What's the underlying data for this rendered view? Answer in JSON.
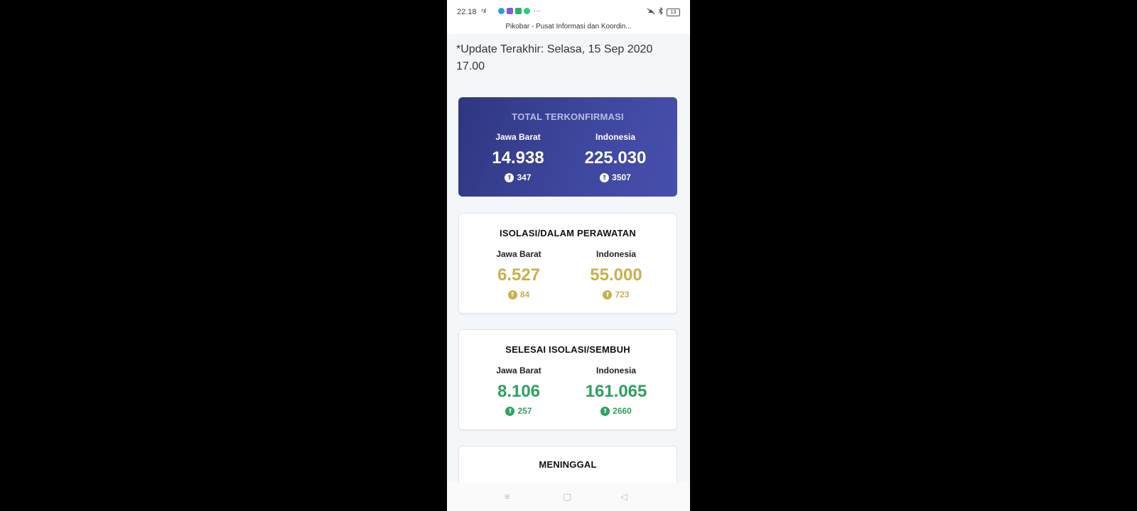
{
  "status_bar": {
    "time": "22.18",
    "signal": "ˢ.ıl",
    "battery": "13",
    "apps": [
      {
        "icon": "telegram-icon",
        "color": "#2a9fd6"
      },
      {
        "icon": "app-icon",
        "color": "#7b5fd9"
      },
      {
        "icon": "chat-icon",
        "color": "#28b463"
      },
      {
        "icon": "whatsapp-icon",
        "color": "#2ecc71"
      }
    ],
    "more": "···"
  },
  "title_bar": {
    "title": "Pikobar - Pusat Informasi dan Koordin..."
  },
  "update_text": "*Update Terakhir: Selasa, 15 Sep 2020 17.00",
  "cards": {
    "confirmed": {
      "title": "TOTAL TERKONFIRMASI",
      "left": {
        "region": "Jawa Barat",
        "value": "14.938",
        "delta": "347"
      },
      "right": {
        "region": "Indonesia",
        "value": "225.030",
        "delta": "3507"
      }
    },
    "isolation": {
      "title": "ISOLASI/DALAM PERAWATAN",
      "left": {
        "region": "Jawa Barat",
        "value": "6.527",
        "delta": "84"
      },
      "right": {
        "region": "Indonesia",
        "value": "55.000",
        "delta": "723"
      }
    },
    "recovered": {
      "title": "SELESAI ISOLASI/SEMBUH",
      "left": {
        "region": "Jawa Barat",
        "value": "8.106",
        "delta": "257"
      },
      "right": {
        "region": "Indonesia",
        "value": "161.065",
        "delta": "2660"
      }
    },
    "deaths": {
      "title": "MENINGGAL"
    }
  },
  "colors": {
    "confirmed_bg": "#3a4394",
    "isolation": "#c9b04c",
    "recovered": "#2ea15e"
  },
  "nav": {
    "menu": "≡",
    "home": "▢",
    "back": "◁"
  }
}
